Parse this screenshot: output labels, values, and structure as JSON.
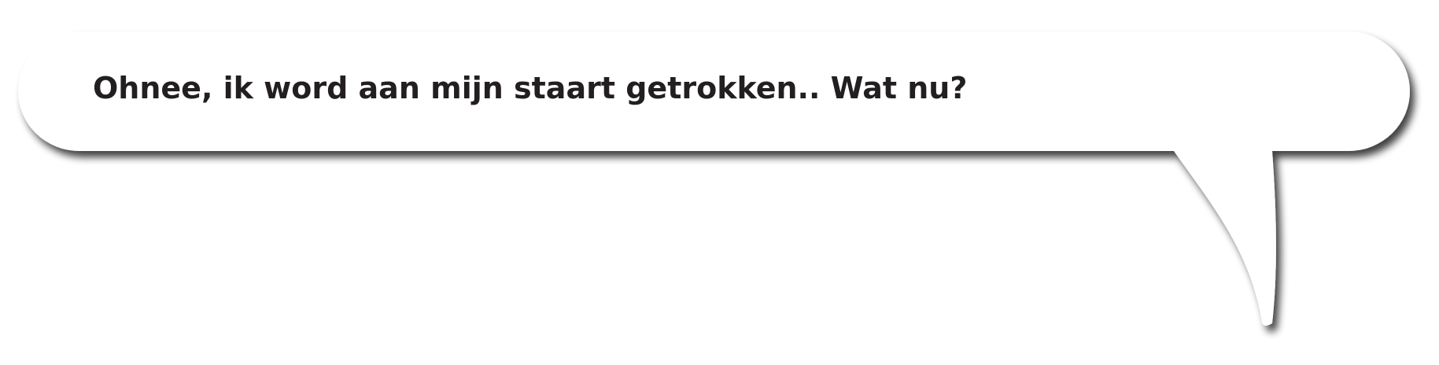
{
  "speech_bubble": {
    "text": "Ohnee, ik word aan mijn staart getrokken.. Wat nu?",
    "fill_color": "#ffffff",
    "text_color": "#231f20",
    "shadow_color": "#5a5a5a"
  }
}
